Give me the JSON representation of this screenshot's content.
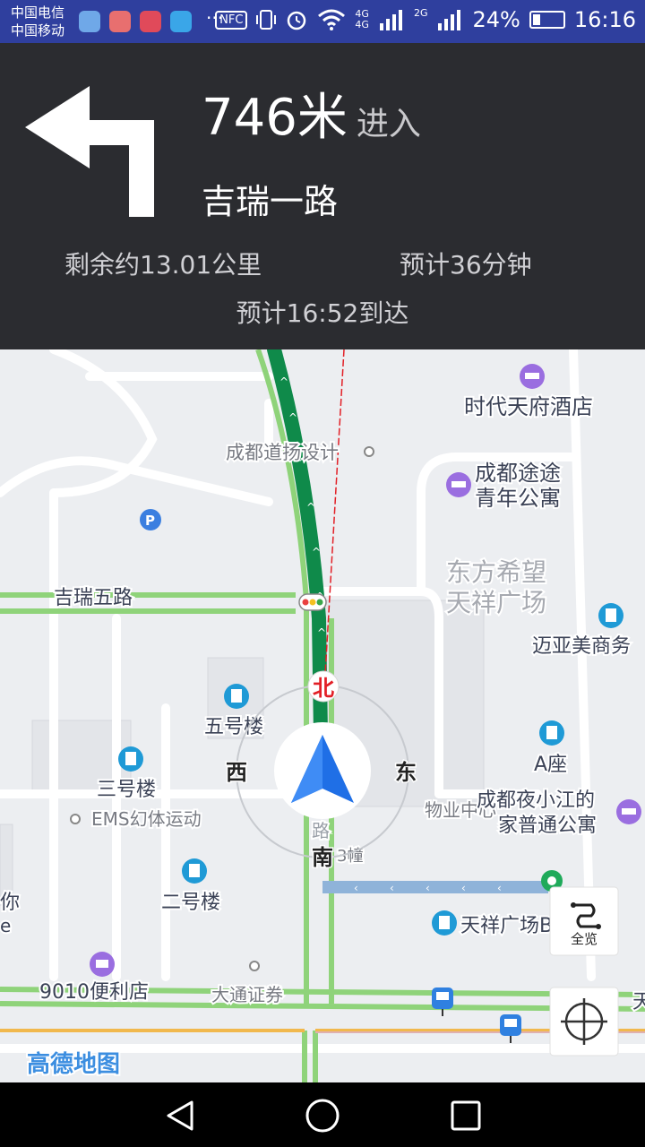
{
  "status_bar": {
    "carrier1": "中国电信",
    "carrier2": "中国移动",
    "more": "···",
    "nfc": "NFC",
    "net1": "4G",
    "net2": "2G",
    "battery_percent": "24%",
    "battery_level": 0.24,
    "time": "16:16"
  },
  "navigation": {
    "maneuver_icon": "turn-left-arrow-icon",
    "distance": "746米",
    "action": "进入",
    "road_name": "吉瑞一路",
    "remaining_distance": "剩余约13.01公里",
    "remaining_time": "预计36分钟",
    "arrival_time": "预计16:52到达"
  },
  "map": {
    "pois": {
      "hotel1": "时代天府酒店",
      "design": "成都道扬设计",
      "hostel_l1": "成都途途",
      "hostel_l2": "青年公寓",
      "plaza_l1": "东方希望",
      "plaza_l2": "天祥广场",
      "office": "迈亚美商务",
      "building5": "五号楼",
      "aseat": "A座",
      "building3": "三号楼",
      "ems": "EMS幻体运动",
      "wuye": "物业中心",
      "apt_l1": "成都夜小江的",
      "apt_l2": "家普通公寓",
      "lou3": "3幢",
      "building2": "二号楼",
      "tianxiang": "天祥广场B",
      "store": "9010便利店",
      "securities": "大通证券",
      "ni": "你",
      "e": "e",
      "roadwu": "五",
      "roadlu": "路",
      "tian": "天"
    },
    "road_label": "吉瑞五路",
    "compass": {
      "north": "北",
      "south": "南",
      "east": "东",
      "west": "西"
    },
    "overview_label": "全览",
    "brand": "高德地图",
    "colors": {
      "route": "#0f8a4a",
      "car_arrow": "#1f6fe6",
      "road_green": "#8fd37a",
      "panel_bg": "#2b2c30"
    }
  },
  "nav_bar": {
    "back_icon": "back-triangle-icon",
    "home_icon": "home-circle-icon",
    "recents_icon": "recents-square-icon"
  }
}
